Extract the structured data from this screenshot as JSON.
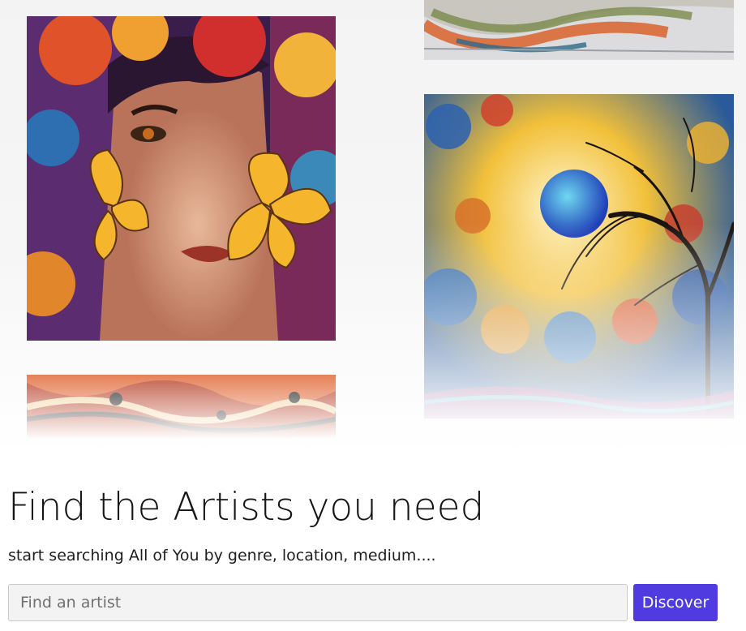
{
  "gallery": {
    "artworks": [
      {
        "name": "woman-with-butterflies-painting"
      },
      {
        "name": "abstract-streaks-painting"
      },
      {
        "name": "blue-moon-tree-painting"
      },
      {
        "name": "marbled-abstract-painting"
      }
    ]
  },
  "hero": {
    "title": "Find the Artists you need",
    "subtitle": "start searching All of You by genre, location, medium...."
  },
  "search": {
    "placeholder": "Find an artist",
    "value": "",
    "button_label": "Discover"
  },
  "colors": {
    "accent": "#4f3be0",
    "input_background": "#f3f3f3"
  }
}
